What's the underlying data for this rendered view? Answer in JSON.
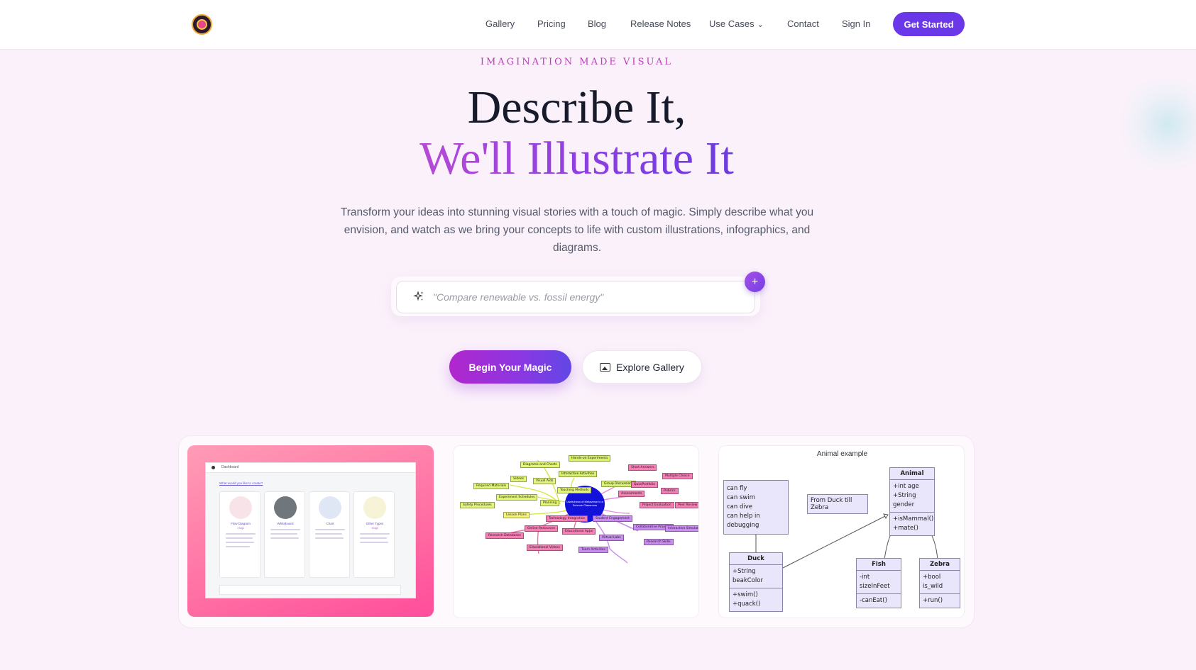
{
  "nav": {
    "links": [
      "Gallery",
      "Pricing",
      "Blog",
      "Release Notes",
      "Use Cases",
      "Contact",
      "Sign In"
    ],
    "cta": "Get Started"
  },
  "hero": {
    "eyebrow": "IMAGINATION MADE VISUAL",
    "title_line1": "Describe It,",
    "title_line2": "We'll Illustrate It",
    "subtitle": "Transform your ideas into stunning visual stories with a touch of magic. Simply describe what you envision, and watch as we bring your concepts to life with custom illustrations, infographics, and diagrams."
  },
  "prompt": {
    "placeholder": "\"Compare renewable vs. fossil energy\""
  },
  "buttons": {
    "primary": "Begin Your Magic",
    "secondary": "Explore Gallery"
  },
  "showcase": {
    "card1": {
      "app_title": "Dashboard",
      "question": "What would you like to create?",
      "types": [
        {
          "name": "Flow Diagram",
          "tag": "4 tags"
        },
        {
          "name": "Whiteboard",
          "tag": ""
        },
        {
          "name": "Chart",
          "tag": ""
        },
        {
          "name": "Other Types",
          "tag": "4 tags"
        }
      ]
    },
    "card2": {
      "center": "Usefulness of Metaverse in a Science Classroom",
      "nodes": [
        "Hands-on Experiments",
        "Diagrams and Charts",
        "Interactive Activities",
        "Short Answers",
        "Videos",
        "Visual Aids",
        "Group Discussions",
        "Multiple Choice",
        "Teaching Methods",
        "Quiz/Portfolio",
        "Required Materials",
        "Experiment Schedules",
        "Assessments",
        "Rubrics",
        "Safety Procedures",
        "Planning",
        "Project Evaluation",
        "Peer Review",
        "Lesson Plans",
        "Technology Integration",
        "Student Engagement",
        "Online Resources",
        "Research Databases",
        "Educational Apps",
        "Virtual Labs",
        "Collaborative Projects",
        "Educational Videos",
        "Team Activities",
        "Interactive Simulations",
        "Research Skills"
      ]
    },
    "card3": {
      "title": "Animal example",
      "note": [
        "can fly",
        "can swim",
        "can dive",
        "can help in debugging"
      ],
      "label": "From Duck till Zebra",
      "animal": {
        "name": "Animal",
        "fields": [
          "+int age",
          "+String gender"
        ],
        "methods": [
          "+isMammal()",
          "+mate()"
        ]
      },
      "duck": {
        "name": "Duck",
        "fields": [
          "+String beakColor"
        ],
        "methods": [
          "+swim()",
          "+quack()"
        ]
      },
      "fish": {
        "name": "Fish",
        "fields": [
          "-int sizeInFeet"
        ],
        "methods": [
          "-canEat()"
        ]
      },
      "zebra": {
        "name": "Zebra",
        "fields": [
          "+bool is_wild"
        ],
        "methods": [
          "+run()"
        ]
      }
    }
  },
  "colors": {
    "accent": "#6a38e8",
    "eyebrow": "#b93fb8",
    "background": "#fbf1fb"
  },
  "icons": {
    "logo": "tiger-logo",
    "prompt": "sparkles-icon",
    "plus": "plus-icon",
    "gallery": "image-icon",
    "dropdown": "chevron-down-icon"
  }
}
